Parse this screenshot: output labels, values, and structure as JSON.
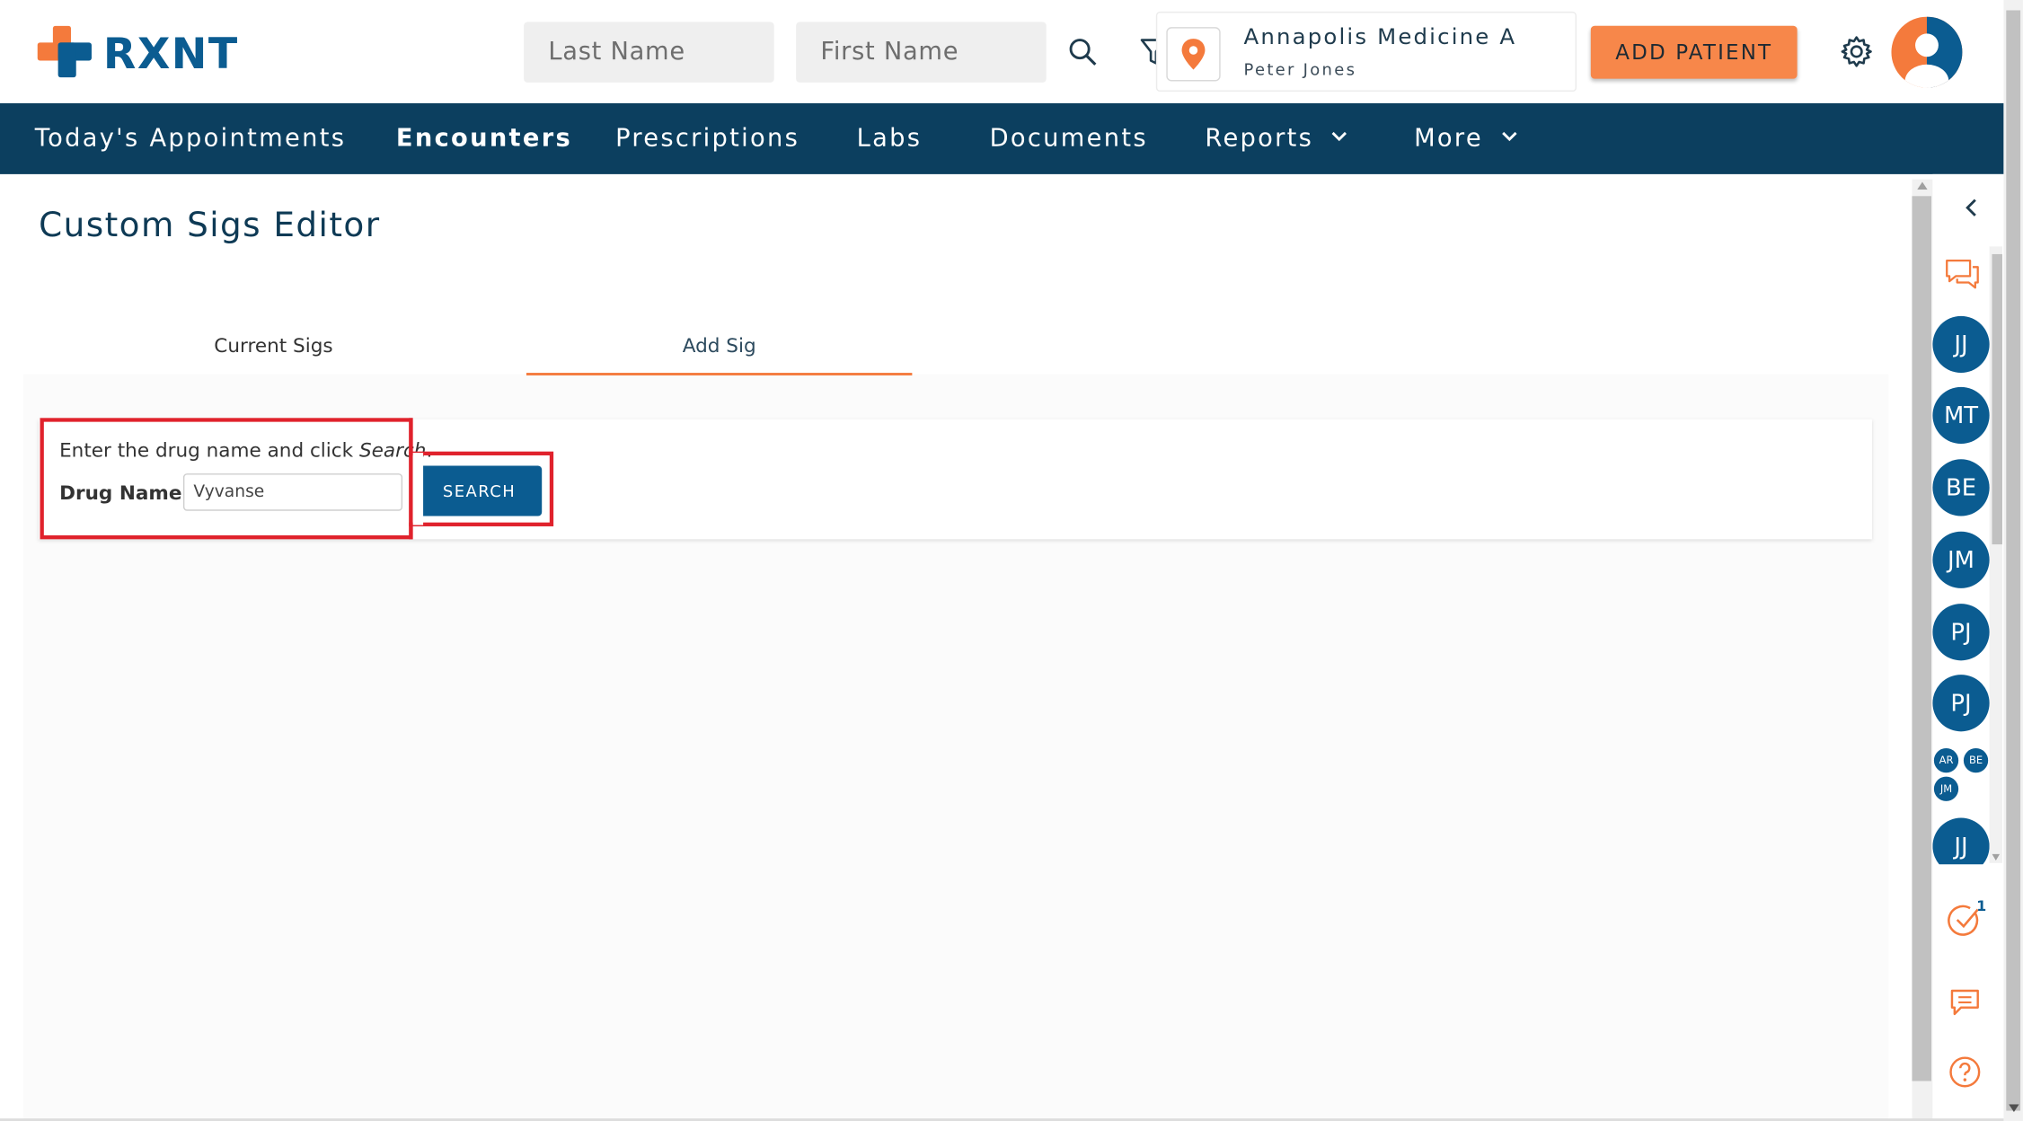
{
  "brand": {
    "name": "RXNT",
    "colors": {
      "primary": "#0b5c91",
      "accent": "#f47a3c",
      "nav_bg": "#0c3f5f",
      "highlight": "#e0222c"
    }
  },
  "header": {
    "last_name_placeholder": "Last Name",
    "first_name_placeholder": "First Name",
    "location": {
      "name": "Annapolis Medicine A",
      "user": "Peter Jones"
    },
    "add_patient_label": "ADD PATIENT",
    "icons": [
      "search-icon",
      "filter-icon",
      "location-pin-icon",
      "gear-icon",
      "user-avatar-icon"
    ]
  },
  "nav": {
    "items": [
      {
        "label": "Today's Appointments"
      },
      {
        "label": "Encounters",
        "active": true
      },
      {
        "label": "Prescriptions"
      },
      {
        "label": "Labs"
      },
      {
        "label": "Documents"
      },
      {
        "label": "Reports",
        "dropdown": true
      },
      {
        "label": "More",
        "dropdown": true
      }
    ]
  },
  "page": {
    "title": "Custom Sigs Editor",
    "tabs": [
      {
        "label": "Current Sigs",
        "active": false
      },
      {
        "label": "Add Sig",
        "active": true
      }
    ],
    "form": {
      "instruction_text": "Enter the drug name and click ",
      "instruction_emphasis": "Search",
      "instruction_end": ".",
      "drug_label": "Drug Name:",
      "drug_value": "Vyvanse",
      "search_label": "SEARCH"
    }
  },
  "sidebar": {
    "avatars": [
      "JJ",
      "MT",
      "BE",
      "JM",
      "PJ",
      "PJ"
    ],
    "group_avatars": [
      "AR",
      "BE",
      "JM"
    ],
    "last_avatar": "JJ",
    "tasks_badge": "1",
    "icons": [
      "collapse-chevron-icon",
      "chat-bubbles-icon",
      "tasks-check-icon",
      "message-icon",
      "help-icon"
    ]
  }
}
